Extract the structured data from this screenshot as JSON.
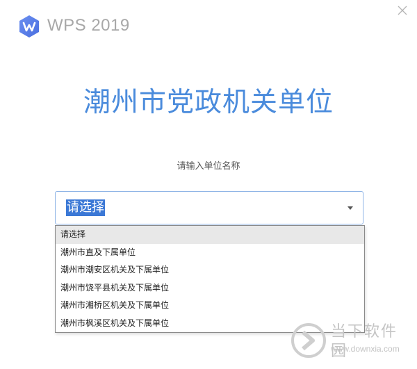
{
  "app": {
    "title": "WPS 2019"
  },
  "header": {
    "page_title": "潮州市党政机关单位"
  },
  "form": {
    "label": "请输入单位名称",
    "select_value": "请选择"
  },
  "dropdown": {
    "items": [
      {
        "label": "请选择",
        "selected": true
      },
      {
        "label": "潮州市直及下属单位",
        "selected": false
      },
      {
        "label": "潮州市潮安区机关及下属单位",
        "selected": false
      },
      {
        "label": "潮州市饶平县机关及下属单位",
        "selected": false
      },
      {
        "label": "潮州市湘桥区机关及下属单位",
        "selected": false
      },
      {
        "label": "潮州市枫溪区机关及下属单位",
        "selected": false
      }
    ]
  },
  "watermark": {
    "name": "当下软件园",
    "url": "www.downxia.com"
  },
  "colors": {
    "accent": "#4a8bdc",
    "logo_blue": "#5a7fe8",
    "selection": "#3b78d6"
  },
  "icons": {
    "logo": "wps-logo-icon",
    "close": "close-icon",
    "dropdown": "chevron-down-icon",
    "watermark": "downxia-logo-icon"
  }
}
